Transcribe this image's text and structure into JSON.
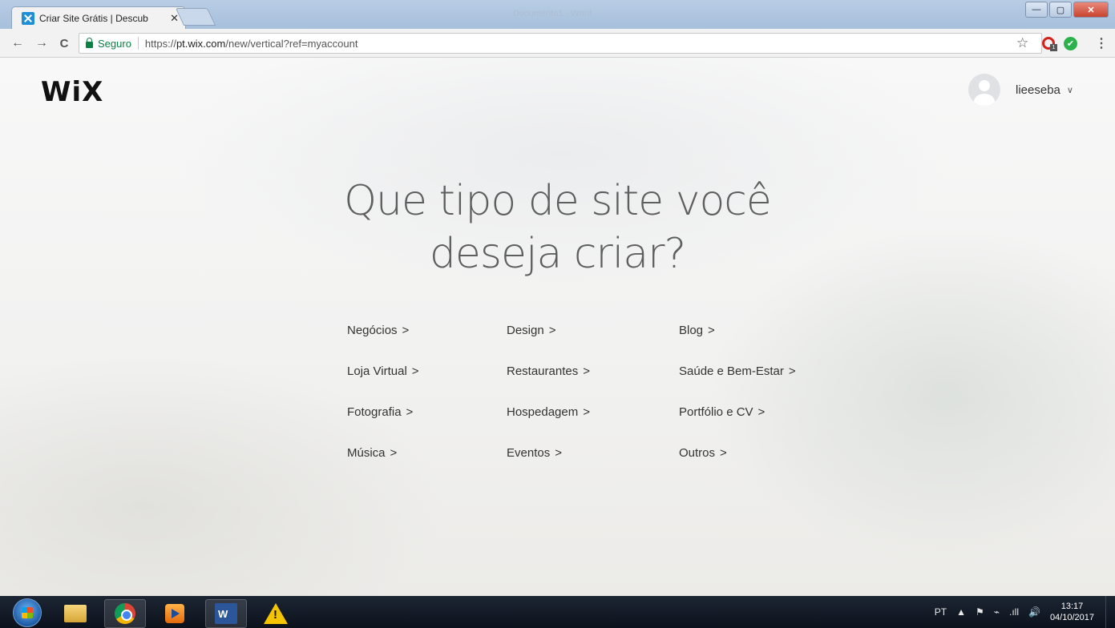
{
  "browser": {
    "tab_title": "Criar Site Grátis | Descub",
    "tab_close": "✕",
    "ghost_title": "Documento1 - Word",
    "window_controls": {
      "minimize": "—",
      "maximize": "▢",
      "close": "✕"
    },
    "nav": {
      "back": "←",
      "forward": "→",
      "reload": "C"
    },
    "secure_label": "Seguro",
    "url_scheme": "https://",
    "url_host": "pt.wix.com",
    "url_path": "/new/vertical?ref=myaccount",
    "star": "☆",
    "extension_badge": "1",
    "extension_check": "✔",
    "menu": "⋮"
  },
  "site": {
    "logo": "WiX",
    "username": "lieeseba",
    "user_chevron": "∨",
    "headline_line1": "Que tipo de site você",
    "headline_line2": "deseja criar?",
    "categories": [
      {
        "label": "Negócios",
        "arrow": ">"
      },
      {
        "label": "Design",
        "arrow": ">"
      },
      {
        "label": "Blog",
        "arrow": ">"
      },
      {
        "label": "Loja Virtual",
        "arrow": ">"
      },
      {
        "label": "Restaurantes",
        "arrow": ">"
      },
      {
        "label": "Saúde e Bem-Estar",
        "arrow": ">"
      },
      {
        "label": "Fotografia",
        "arrow": ">"
      },
      {
        "label": "Hospedagem",
        "arrow": ">"
      },
      {
        "label": "Portfólio e CV",
        "arrow": ">"
      },
      {
        "label": "Música",
        "arrow": ">"
      },
      {
        "label": "Eventos",
        "arrow": ">"
      },
      {
        "label": "Outros",
        "arrow": ">"
      }
    ]
  },
  "taskbar": {
    "word_letter": "W",
    "tray_lang": "PT",
    "tray_up": "▲",
    "tray_flag": "⚑",
    "tray_power": "⌁",
    "tray_signal": ".ıll",
    "tray_volume": "🔊",
    "clock_time": "13:17",
    "clock_date": "04/10/2017"
  },
  "colors": {
    "secure_green": "#0b8043",
    "titlebar_blue": "#a6bfdc",
    "taskbar_dark": "#0c121c"
  }
}
